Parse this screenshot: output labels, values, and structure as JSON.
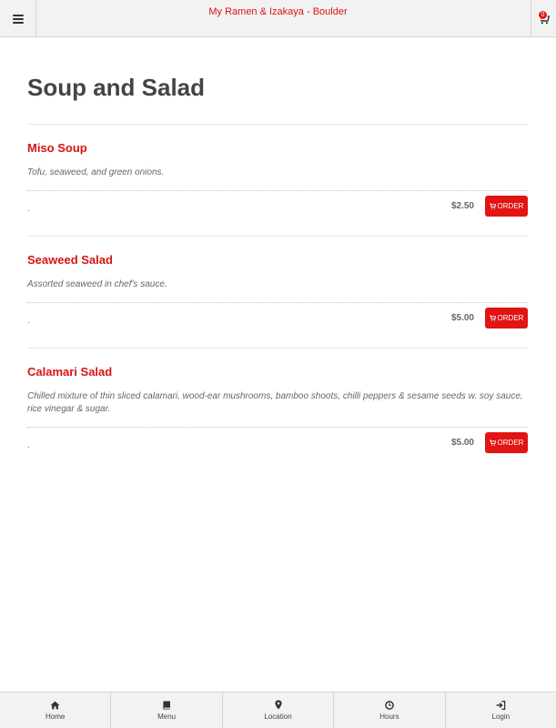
{
  "header": {
    "site_title": "My Ramen & Izakaya - Boulder",
    "cart_count": "0"
  },
  "page": {
    "title": "Soup and Salad"
  },
  "items": [
    {
      "name": "Miso Soup",
      "description": "Tofu, seaweed, and green onions.",
      "option": ".",
      "price": "$2.50",
      "order_label": "ORDER"
    },
    {
      "name": "Seaweed Salad",
      "description": "Assorted seaweed in chef's sauce.",
      "option": ".",
      "price": "$5.00",
      "order_label": "ORDER"
    },
    {
      "name": "Calamari Salad",
      "description": "Chilled mixture of thin sliced calamari, wood-ear mushrooms, bamboo shoots, chilli peppers & sesame seeds w. soy sauce, rice vinegar & sugar.",
      "option": ".",
      "price": "$5.00",
      "order_label": "ORDER"
    }
  ],
  "tabbar": {
    "home": "Home",
    "menu": "Menu",
    "location": "Location",
    "hours": "Hours",
    "login": "Login"
  },
  "colors": {
    "accent": "#d81414",
    "button": "#e21414",
    "bar": "#f2f2f2"
  },
  "icons": [
    "hamburger-icon",
    "cart-icon",
    "home-icon",
    "book-icon",
    "map-pin-icon",
    "clock-icon",
    "sign-in-icon"
  ]
}
